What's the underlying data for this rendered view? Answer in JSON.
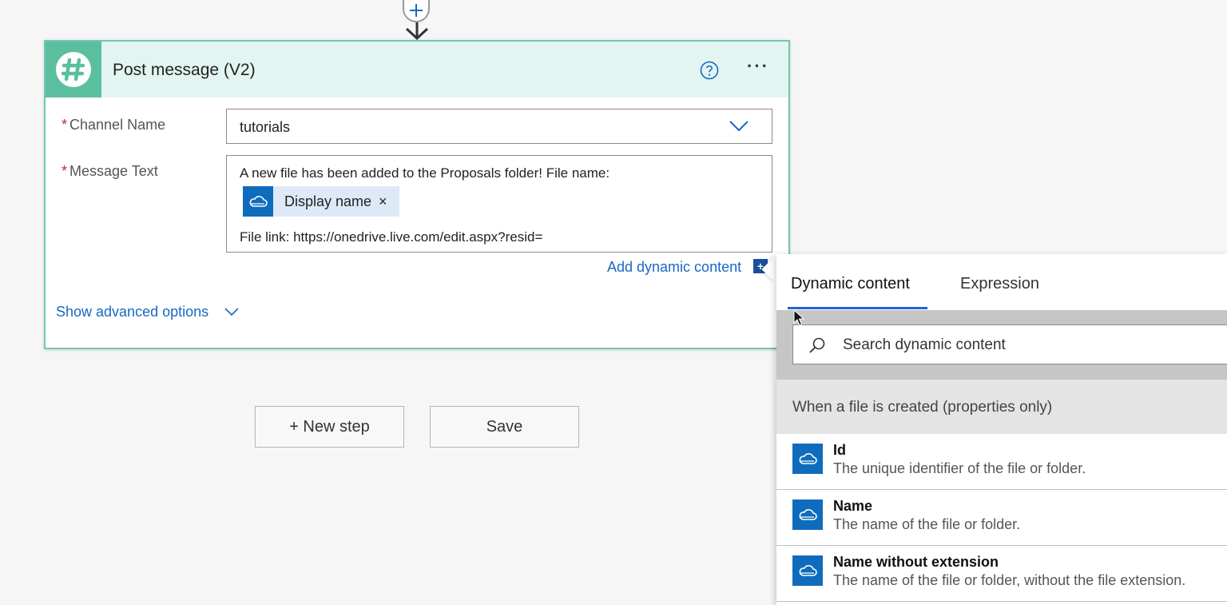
{
  "card": {
    "title": "Post message (V2)",
    "more_label": "···",
    "channel": {
      "label": "Channel Name",
      "value": "tutorials"
    },
    "message": {
      "label": "Message Text",
      "line1": "A new file has been added to the Proposals folder!  File name:",
      "token_label": "Display name",
      "token_close": "×",
      "line3": "File link: https://onedrive.live.com/edit.aspx?resid="
    },
    "required_mark": "*",
    "add_dynamic_label": "Add dynamic content",
    "add_dynamic_glyph": "+",
    "advanced_label": "Show advanced options"
  },
  "buttons": {
    "new_step": "+ New step",
    "save": "Save"
  },
  "panel": {
    "tabs": [
      "Dynamic content",
      "Expression"
    ],
    "search_placeholder": "Search dynamic content",
    "section_title": "When a file is created (properties only)",
    "items": [
      {
        "title": "Id",
        "desc": "The unique identifier of the file or folder."
      },
      {
        "title": "Name",
        "desc": "The name of the file or folder."
      },
      {
        "title": "Name without extension",
        "desc": "The name of the file or folder, without the file extension."
      }
    ]
  },
  "colors": {
    "accent": "#2266dd",
    "slack_green": "#5bbf9f",
    "onedrive_blue": "#0f6cbd",
    "required_red": "#c1262b"
  }
}
